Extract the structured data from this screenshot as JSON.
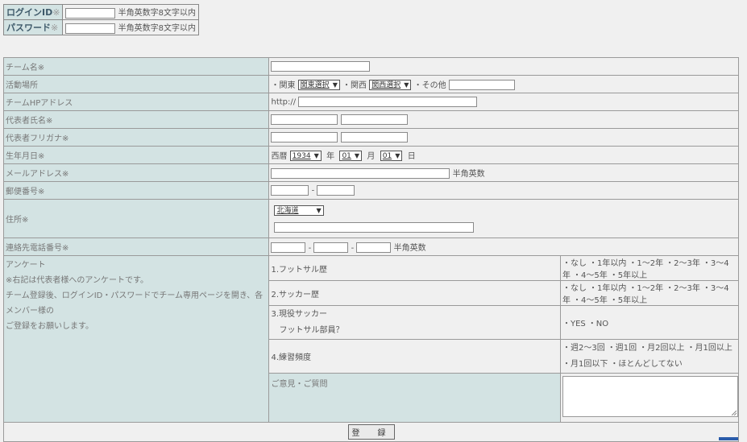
{
  "login": {
    "id_label": "ログインID",
    "pw_label": "パスワード",
    "req": "※",
    "hint": "半角英数字8文字以内"
  },
  "form": {
    "req": "※",
    "team_name": "チーム名",
    "area": "活動場所",
    "area_kanto": "関東",
    "area_kanto_select": "関東選択",
    "area_kansai": "関西",
    "area_kansai_select": "関西選択",
    "area_other": "その他",
    "hp": "チームHPアドレス",
    "hp_prefix": "http://",
    "rep_name": "代表者氏名",
    "rep_kana": "代表者フリガナ",
    "birth": "生年月日",
    "era": "西暦",
    "year": "1934",
    "year_unit": "年",
    "month": "01",
    "month_unit": "月",
    "day": "01",
    "day_unit": "日",
    "email": "メールアドレス",
    "email_hint": "半角英数",
    "postal": "郵便番号",
    "dash": "-",
    "address": "住所",
    "pref": "北海道",
    "phone": "連絡先電話番号",
    "phone_hint": "半角英数",
    "survey_title": "アンケート",
    "survey_note1": "※右記は代表者様へのアンケートです。",
    "survey_note2": "チーム登録後、ログインID・パスワードでチーム専用ページを開き、各メンバー様の",
    "survey_note3": "ご登録をお願いします。",
    "q1": "1.フットサル歴",
    "q2": "2.サッカー歴",
    "q3a": "3.現役サッカー",
    "q3b": "フットサル部員？",
    "q4": "4.練習頻度",
    "exp_opts": [
      "なし",
      "1年以内",
      "1〜2年",
      "2〜3年",
      "3〜4年",
      "4〜5年",
      "5年以上"
    ],
    "yn_opts": [
      "YES",
      "NO"
    ],
    "freq_opts1": [
      "週2〜3回",
      "週1回",
      "月2回以上",
      "月1回以上"
    ],
    "freq_opts2": [
      "月1回以下",
      "ほとんどしてない"
    ],
    "comment": "ご意見・ご質問",
    "submit": "登　録"
  }
}
